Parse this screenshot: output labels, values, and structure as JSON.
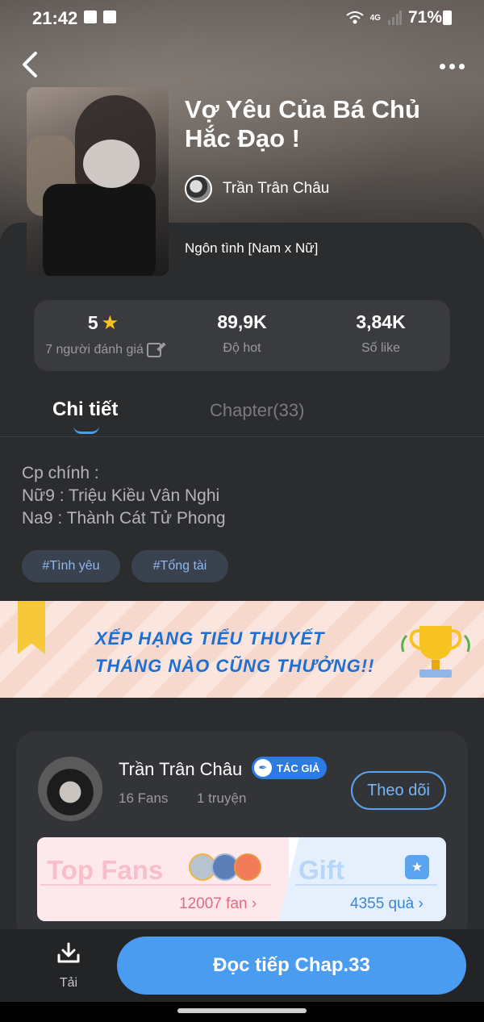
{
  "status_bar": {
    "time": "21:42",
    "network": "4G",
    "battery": "71%"
  },
  "book": {
    "title": "Vợ Yêu Của Bá Chủ Hắc Đạo !",
    "author": "Trần Trân Châu",
    "genre": "Ngôn tình [Nam x Nữ]"
  },
  "stats": {
    "rating": "5",
    "rating_label": "7 người đánh giá",
    "hot": "89,9K",
    "hot_label": "Độ hot",
    "likes": "3,84K",
    "likes_label": "Số like"
  },
  "tabs": {
    "detail": "Chi tiết",
    "chapter": "Chapter(33)"
  },
  "description": {
    "line1": "Cp chính :",
    "line2": "Nữ9 : Triệu Kiều Vân Nghi",
    "line3": "Na9 : Thành Cát Tử Phong"
  },
  "tags": [
    "#Tình yêu",
    "#Tổng tài"
  ],
  "banner": {
    "line1": "XẾP HẠNG TIỂU THUYẾT",
    "line2": "THÁNG NÀO CŨNG THƯỞNG!!"
  },
  "author_card": {
    "name": "Trần Trân Châu",
    "badge": "TÁC GIẢ",
    "fans": "16 Fans",
    "works": "1 truyện",
    "follow": "Theo dõi",
    "top_fans": "Top Fans",
    "fan_count": "12007 fan",
    "gift": "Gift",
    "gift_count": "4355 quà"
  },
  "bottom": {
    "download": "Tải",
    "read": "Đọc tiếp Chap.33"
  },
  "colors": {
    "accent": "#4a9cf0",
    "star": "#ffc21d",
    "background": "#2b2c2e"
  }
}
